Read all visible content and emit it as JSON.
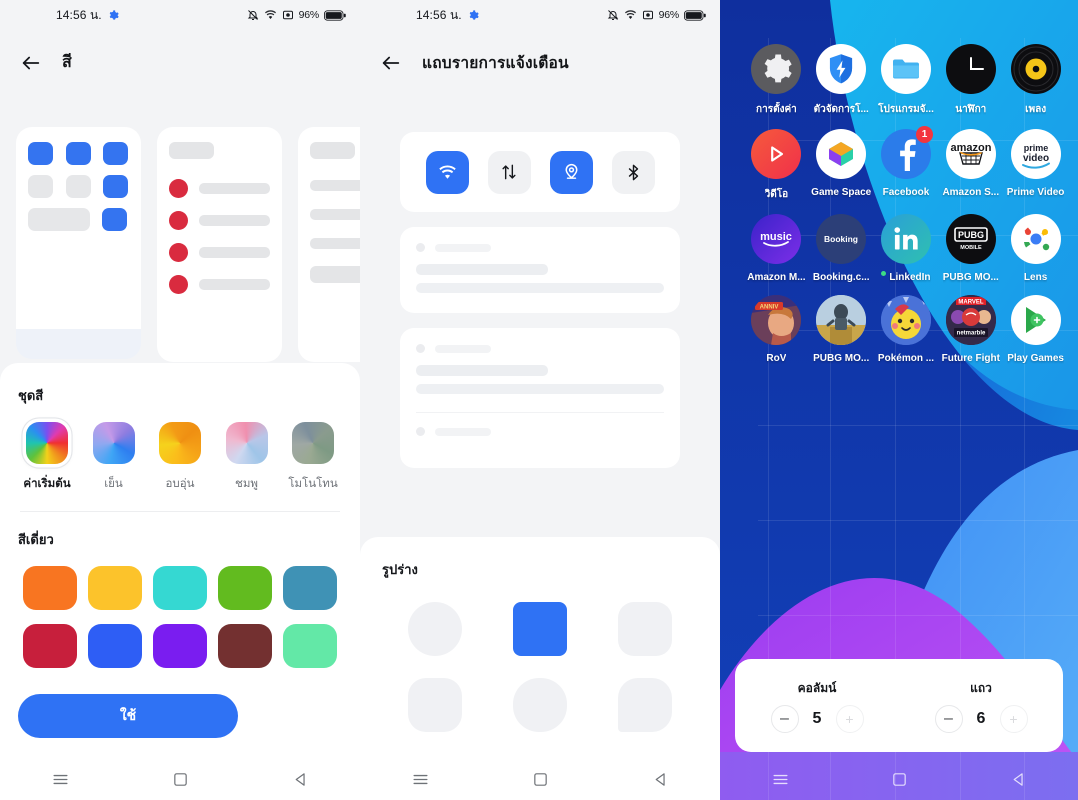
{
  "status_bar": {
    "time": "14:56 น.",
    "gear_icon": "gear-icon",
    "icons": [
      "bell-off-icon",
      "wifi-icon",
      "screen-record-icon"
    ],
    "battery_pct": "96%"
  },
  "panel_color": {
    "title": "สี",
    "back_icon": "back-arrow-icon",
    "preview": {
      "card1_name": "home-layout-preview",
      "card2_name": "list-layout-preview",
      "card3_name": "detail-layout-preview"
    },
    "theme_section": {
      "title": "ชุดสี",
      "items": [
        {
          "label": "ค่าเริ่มต้น",
          "selected": true,
          "gradient": "conic-gradient(from 90deg, #f03030, #f08a1e, #f3d11a, #5fc23b, #1fc4b0, #2b8ff0, #7a4ff0, #e03bb0, #f03030)"
        },
        {
          "label": "เย็น",
          "selected": false,
          "gradient": "conic-gradient(from 120deg, #2e7ef0, #3fa6f5, #8ea8f0, #c49ae8, #8f7de0, #2e7ef0)"
        },
        {
          "label": "อบอุ่น",
          "selected": false,
          "gradient": "conic-gradient(from 120deg, #f5a318, #fbbc1b, #f5d21c, #f39b16, #ef8f12, #f5a318)"
        },
        {
          "label": "ชมพู",
          "selected": false,
          "gradient": "conic-gradient(from 140deg, #9fc5e8, #cfd8f0, #f0b8cf, #f08fae, #b9c6e8, #9fc5e8)"
        },
        {
          "label": "โมโนโทน",
          "selected": false,
          "gradient": "conic-gradient(from 120deg, #7e9a84, #9aa992, #9fa8a4, #7d8f9c, #8a9b8e, #7e9a84)"
        }
      ]
    },
    "single_color_section": {
      "title": "สีเดี่ยว",
      "colors": [
        "#f87521",
        "#fcc32b",
        "#35d8d2",
        "#62bb1f",
        "#3f92b5",
        "#c71f3c",
        "#2e5ef5",
        "#7a1df0",
        "#733030",
        "#63e8a7"
      ]
    },
    "apply_button": "ใช้"
  },
  "panel_notification": {
    "title": "แถบรายการแจ้งเตือน",
    "back_icon": "back-arrow-icon",
    "quick_settings": [
      {
        "name": "wifi-toggle",
        "icon": "wifi-icon",
        "on": true
      },
      {
        "name": "mobile-data-toggle",
        "icon": "data-transfer-icon",
        "on": false
      },
      {
        "name": "location-toggle",
        "icon": "location-pin-icon",
        "on": true
      },
      {
        "name": "bluetooth-toggle",
        "icon": "bluetooth-icon",
        "on": false
      }
    ],
    "shape_section": {
      "title": "รูปร่าง",
      "shapes": [
        {
          "name": "circle",
          "radius": "50%",
          "selected": false
        },
        {
          "name": "rounded-square",
          "radius": "8px",
          "selected": true
        },
        {
          "name": "squircle",
          "radius": "16px",
          "selected": false
        },
        {
          "name": "octagon",
          "radius": "18px",
          "selected": false
        },
        {
          "name": "superellipse",
          "radius": "26px",
          "selected": false
        },
        {
          "name": "teardrop",
          "radius": "20px 20px 20px 4px",
          "selected": false
        }
      ]
    }
  },
  "panel_home": {
    "apps": [
      {
        "label": "การตั้งค่า",
        "icon": "settings-gear-icon"
      },
      {
        "label": "ตัวจัดการโ...",
        "icon": "phone-manager-shield-icon"
      },
      {
        "label": "โปรแกรมจั...",
        "icon": "file-manager-folder-icon"
      },
      {
        "label": "นาฬิกา",
        "icon": "clock-icon"
      },
      {
        "label": "เพลง",
        "icon": "music-vinyl-icon"
      },
      {
        "label": "วิดีโอ",
        "icon": "video-play-icon"
      },
      {
        "label": "Game Space",
        "icon": "game-space-icon"
      },
      {
        "label": "Facebook",
        "icon": "facebook-icon",
        "badge": "1"
      },
      {
        "label": "Amazon S...",
        "icon": "amazon-shopping-icon"
      },
      {
        "label": "Prime Video",
        "icon": "prime-video-icon"
      },
      {
        "label": "Amazon M...",
        "icon": "amazon-music-icon"
      },
      {
        "label": "Booking.c...",
        "icon": "booking-icon"
      },
      {
        "label": "LinkedIn",
        "icon": "linkedin-icon",
        "dot": true
      },
      {
        "label": "PUBG MO...",
        "icon": "pubg-mobile-icon"
      },
      {
        "label": "Lens",
        "icon": "google-lens-icon"
      },
      {
        "label": "RoV",
        "icon": "rov-icon"
      },
      {
        "label": "PUBG MO...",
        "icon": "pubg-mobile-alt-icon"
      },
      {
        "label": "Pokémon ...",
        "icon": "pokemon-go-icon"
      },
      {
        "label": "Future Fight",
        "icon": "marvel-future-fight-icon"
      },
      {
        "label": "Play Games",
        "icon": "google-play-games-icon"
      }
    ],
    "layout_controls": {
      "columns": {
        "label": "คอลัมน์",
        "value": "5",
        "minus": "–",
        "plus": "+"
      },
      "rows": {
        "label": "แถว",
        "value": "6",
        "minus": "–",
        "plus": "+"
      }
    }
  },
  "nav_bar": {
    "recents_icon": "recents-menu-icon",
    "home_icon": "home-square-icon",
    "back_icon": "back-triangle-icon"
  }
}
